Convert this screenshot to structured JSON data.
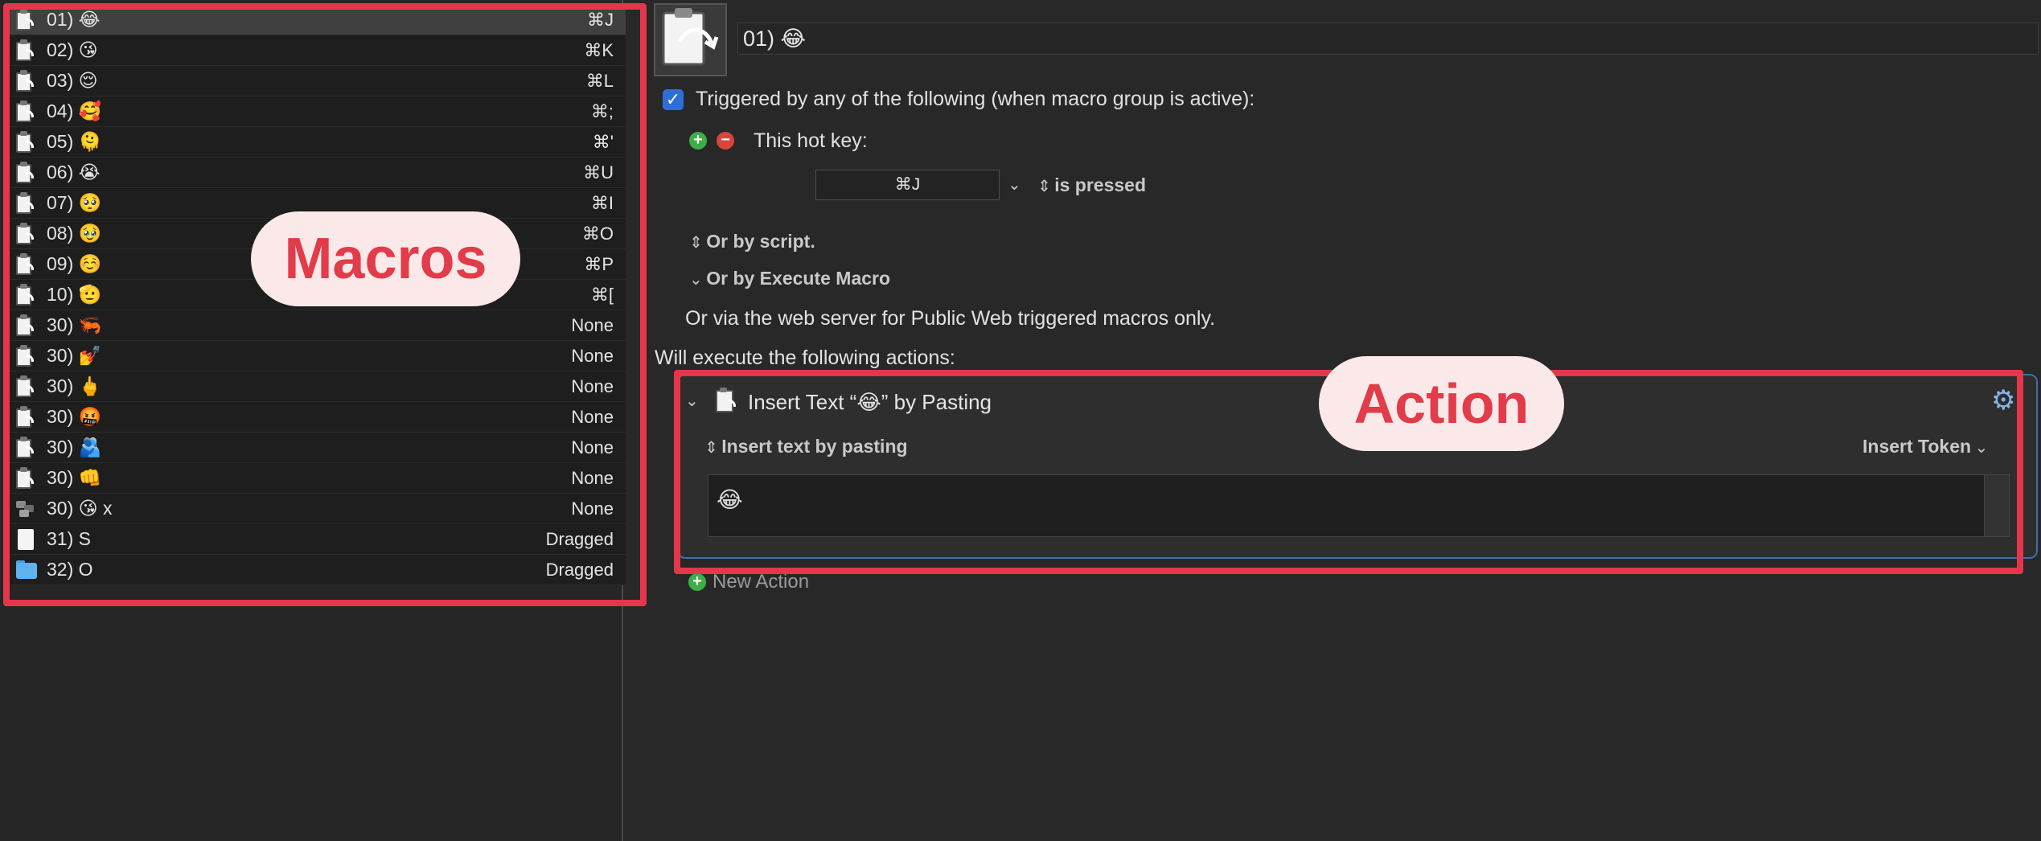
{
  "macros": [
    {
      "label": "01) 😂",
      "key": "⌘J",
      "icon": "clipboard-paste-icon",
      "selected": true
    },
    {
      "label": "02) 😘",
      "key": "⌘K",
      "icon": "clipboard-paste-icon"
    },
    {
      "label": "03) 😌",
      "key": "⌘L",
      "icon": "clipboard-paste-icon"
    },
    {
      "label": "04) 🥰",
      "key": "⌘;",
      "icon": "clipboard-paste-icon"
    },
    {
      "label": "05) 🫠",
      "key": "⌘'",
      "icon": "clipboard-paste-icon"
    },
    {
      "label": "06) 😭",
      "key": "⌘U",
      "icon": "clipboard-paste-icon"
    },
    {
      "label": "07) 🥺",
      "key": "⌘I",
      "icon": "clipboard-paste-icon"
    },
    {
      "label": "08) 🥹",
      "key": "⌘O",
      "icon": "clipboard-paste-icon"
    },
    {
      "label": "09) ☺️",
      "key": "⌘P",
      "icon": "clipboard-paste-icon"
    },
    {
      "label": "10) 🫡",
      "key": "⌘[",
      "icon": "clipboard-paste-icon"
    },
    {
      "label": "30) 🦐",
      "key": "None",
      "icon": "clipboard-paste-icon"
    },
    {
      "label": "30) 💅",
      "key": "None",
      "icon": "clipboard-paste-icon"
    },
    {
      "label": "30) 🖕",
      "key": "None",
      "icon": "clipboard-paste-icon"
    },
    {
      "label": "30) 🤬",
      "key": "None",
      "icon": "clipboard-paste-icon"
    },
    {
      "label": "30) 🫂",
      "key": "None",
      "icon": "clipboard-paste-icon"
    },
    {
      "label": "30) 👊",
      "key": "None",
      "icon": "clipboard-paste-icon"
    },
    {
      "label": "30) 😘 x",
      "key": "None",
      "icon": "macro-stack-icon"
    },
    {
      "label": "31) S",
      "key": "Dragged",
      "icon": "document-icon"
    },
    {
      "label": "32) O",
      "key": "Dragged",
      "icon": "folder-icon"
    }
  ],
  "editor": {
    "macro_name": "01) 😂",
    "trigger_text": "Triggered by any of the following (when macro group is active):",
    "trigger_checked": true,
    "hotkey_title": "This hot key:",
    "hotkey_value": "⌘J",
    "hotkey_condition": "is pressed",
    "or_by_script": "Or by script.",
    "or_by_execute": "Or by Execute Macro",
    "web_server_text": "Or via the web server for Public Web triggered macros only.",
    "will_execute": "Will execute the following actions:",
    "action_title": "Insert Text “😂” by Pasting",
    "action_mode": "Insert text by pasting",
    "insert_token": "Insert Token",
    "insert_text_value": "😂",
    "new_action": "New Action"
  },
  "callouts": {
    "macros": "Macros",
    "action": "Action"
  },
  "colors": {
    "callout_red": "#e5364b",
    "callout_fill": "#fbe9e9",
    "checkbox_blue": "#2f6fd4",
    "add_green": "#3fae49",
    "remove_red": "#d9443b"
  }
}
